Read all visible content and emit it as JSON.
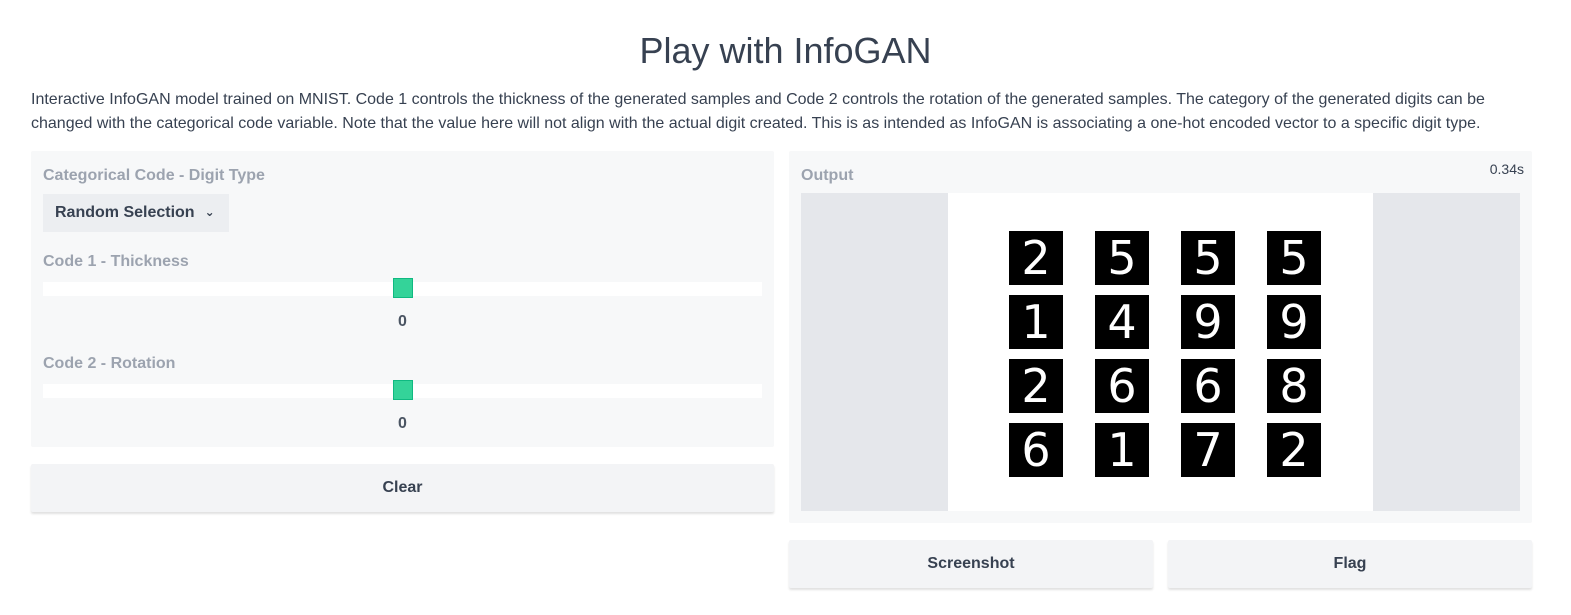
{
  "page": {
    "title": "Play with InfoGAN",
    "description": "Interactive InfoGAN model trained on MNIST. Code 1 controls the thickness of the generated samples and Code 2 controls the rotation of the generated samples. The category of the generated digits can be changed with the categorical code variable. Note that the value here will not align with the actual digit created. This is as intended as InfoGAN is associating a one-hot encoded vector to a specific digit type."
  },
  "inputs": {
    "categorical": {
      "label": "Categorical Code - Digit Type",
      "selected": "Random Selection",
      "icon": "chevron-down-icon"
    },
    "code1": {
      "label": "Code 1 - Thickness",
      "value": "0",
      "position_fraction": 0.5
    },
    "code2": {
      "label": "Code 2 - Rotation",
      "value": "0",
      "position_fraction": 0.5
    },
    "clear_label": "Clear"
  },
  "output": {
    "label": "Output",
    "time": "0.34s",
    "digits": [
      "2",
      "5",
      "5",
      "5",
      "1",
      "4",
      "9",
      "9",
      "2",
      "6",
      "6",
      "8",
      "6",
      "1",
      "7",
      "2"
    ]
  },
  "actions": {
    "screenshot_label": "Screenshot",
    "flag_label": "Flag"
  },
  "colors": {
    "slider_handle": "#34d399",
    "panel_bg": "#f7f8f9",
    "button_bg": "#f3f4f6"
  }
}
